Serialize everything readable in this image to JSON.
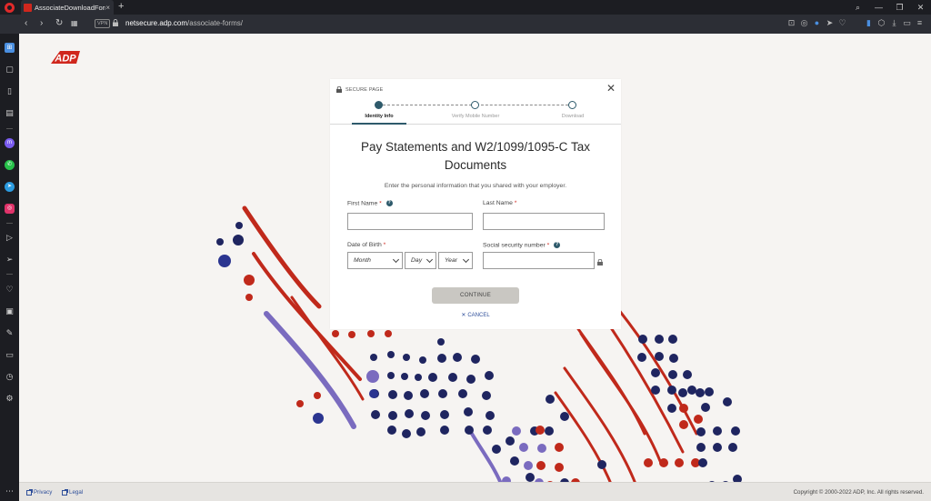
{
  "browser": {
    "tab_title": "AssociateDownloadForms",
    "tab_close": "×",
    "new_tab": "+",
    "vpn_label": "VPN",
    "url_host": "netsecure.adp.com",
    "url_path": "/associate-forms/",
    "window_controls": {
      "search": "⌕",
      "minimize": "—",
      "restore": "❐",
      "close": "✕"
    }
  },
  "brand": {
    "logo_text": "ADP",
    "logo_color": "#d0271d"
  },
  "modal": {
    "secure_label": "SECURE PAGE",
    "close": "✕",
    "steps": [
      {
        "label": "Identity Info",
        "active": true
      },
      {
        "label": "Verify Mobile Number",
        "active": false
      },
      {
        "label": "Download",
        "active": false
      }
    ],
    "title_line1": "Pay Statements and W2/1099/1095-C Tax",
    "title_line2": "Documents",
    "subtitle": "Enter the personal information that you shared with your employer.",
    "fields": {
      "first_name": {
        "label": "First Name",
        "required": "*",
        "value": ""
      },
      "last_name": {
        "label": "Last Name",
        "required": "*",
        "value": ""
      },
      "dob": {
        "label": "Date of Birth",
        "required": "*",
        "month": "Month",
        "day": "Day",
        "year": "Year"
      },
      "ssn": {
        "label": "Social security number",
        "required": "*",
        "value": ""
      }
    },
    "info_glyph": "?",
    "continue_label": "CONTINUE",
    "cancel_label": "CANCEL",
    "cancel_glyph": "✕"
  },
  "footer": {
    "privacy": "Privacy",
    "legal": "Legal",
    "copyright": "Copyright © 2000-2022 ADP, Inc. All rights reserved."
  },
  "colors": {
    "accent": "#2e5a6b",
    "link": "#2f4f9a",
    "red": "#c0291b",
    "navy": "#1f2560",
    "purple": "#7a6bbf"
  }
}
